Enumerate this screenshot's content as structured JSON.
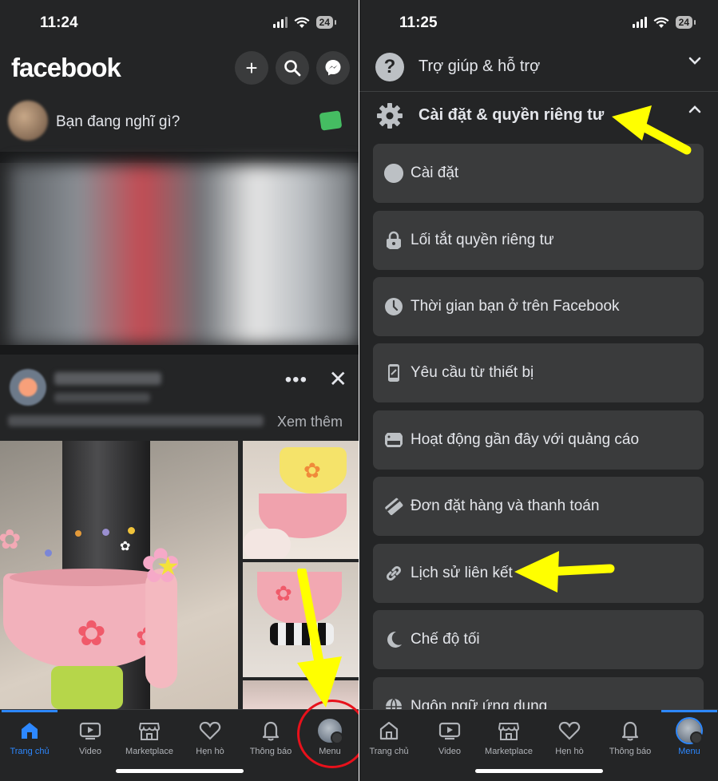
{
  "left": {
    "status": {
      "time": "11:24",
      "battery": "24"
    },
    "header": {
      "logo": "facebook",
      "buttons": [
        "plus-icon",
        "search-icon",
        "messenger-icon"
      ]
    },
    "composer": {
      "prompt": "Bạn đang nghĩ gì?"
    },
    "post": {
      "see_more": "Xem thêm"
    },
    "nav": [
      {
        "label": "Trang chủ",
        "icon": "home-icon",
        "active": true
      },
      {
        "label": "Video",
        "icon": "video-icon",
        "active": false
      },
      {
        "label": "Marketplace",
        "icon": "marketplace-icon",
        "active": false
      },
      {
        "label": "Hẹn hò",
        "icon": "dating-heart-icon",
        "active": false
      },
      {
        "label": "Thông báo",
        "icon": "bell-icon",
        "active": false
      },
      {
        "label": "Menu",
        "icon": "profile-avatar-icon",
        "active": false
      }
    ]
  },
  "right": {
    "status": {
      "time": "11:25",
      "battery": "24"
    },
    "sections": [
      {
        "title": "Trợ giúp & hỗ trợ",
        "icon": "help-question-icon",
        "expanded": false
      },
      {
        "title": "Cài đặt & quyền riêng tư",
        "icon": "gear-icon",
        "expanded": true
      }
    ],
    "items": [
      {
        "label": "Cài đặt",
        "icon": "profile-settings-icon"
      },
      {
        "label": "Lối tắt quyền riêng tư",
        "icon": "lock-icon"
      },
      {
        "label": "Thời gian bạn ở trên Facebook",
        "icon": "clock-icon"
      },
      {
        "label": "Yêu cầu từ thiết bị",
        "icon": "device-request-icon"
      },
      {
        "label": "Hoạt động gần đây với quảng cáo",
        "icon": "ad-activity-icon"
      },
      {
        "label": "Đơn đặt hàng và thanh toán",
        "icon": "payment-card-icon"
      },
      {
        "label": "Lịch sử liên kết",
        "icon": "link-icon"
      },
      {
        "label": "Chế độ tối",
        "icon": "moon-icon"
      },
      {
        "label": "Ngôn ngữ ứng dụng",
        "icon": "globe-icon"
      }
    ],
    "nav": [
      {
        "label": "Trang chủ",
        "icon": "home-icon",
        "active": false
      },
      {
        "label": "Video",
        "icon": "video-icon",
        "active": false
      },
      {
        "label": "Marketplace",
        "icon": "marketplace-icon",
        "active": false
      },
      {
        "label": "Hẹn hò",
        "icon": "dating-heart-icon",
        "active": false
      },
      {
        "label": "Thông báo",
        "icon": "bell-icon",
        "active": false
      },
      {
        "label": "Menu",
        "icon": "profile-avatar-icon",
        "active": true
      }
    ]
  },
  "colors": {
    "background": "#242526",
    "card": "#3a3b3c",
    "accent": "#2d88ff",
    "annotation_arrow": "#ffff00",
    "annotation_circle": "#e8111b"
  }
}
